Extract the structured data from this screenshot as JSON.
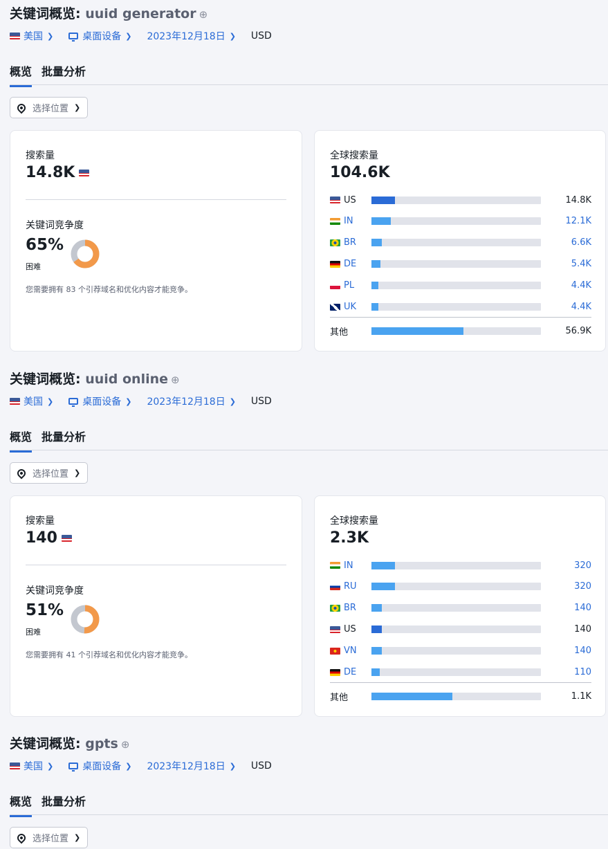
{
  "panels": [
    {
      "title_prefix": "关键词概览: ",
      "keyword": "uuid generator",
      "add_icon": "⊕",
      "filters": {
        "country": "美国",
        "device": "桌面设备",
        "date": "2023年12月18日",
        "currency": "USD"
      },
      "tabs": [
        "概览",
        "批量分析"
      ],
      "location": "选择位置",
      "volume_label": "搜索量",
      "volume": "14.8K",
      "kd_label": "关键词竞争度",
      "kd_value": "65%",
      "kd_percent": 65,
      "kd_level": "困难",
      "kd_note": "您需要拥有 83 个引荐域名和优化内容才能竞争。",
      "global_label": "全球搜索量",
      "global_volume": "104.6K",
      "countries": [
        {
          "code": "US",
          "value": "14.8K",
          "share": 0.14
        },
        {
          "code": "IN",
          "value": "12.1K",
          "share": 0.115
        },
        {
          "code": "BR",
          "value": "6.6K",
          "share": 0.063
        },
        {
          "code": "DE",
          "value": "5.4K",
          "share": 0.052
        },
        {
          "code": "PL",
          "value": "4.4K",
          "share": 0.042
        },
        {
          "code": "UK",
          "value": "4.4K",
          "share": 0.042
        }
      ],
      "other_label": "其他",
      "other_value": "56.9K",
      "other_share": 0.544
    },
    {
      "title_prefix": "关键词概览: ",
      "keyword": "uuid online",
      "add_icon": "⊕",
      "filters": {
        "country": "美国",
        "device": "桌面设备",
        "date": "2023年12月18日",
        "currency": "USD"
      },
      "tabs": [
        "概览",
        "批量分析"
      ],
      "location": "选择位置",
      "volume_label": "搜索量",
      "volume": "140",
      "kd_label": "关键词竞争度",
      "kd_value": "51%",
      "kd_percent": 51,
      "kd_level": "困难",
      "kd_note": "您需要拥有 41 个引荐域名和优化内容才能竞争。",
      "global_label": "全球搜索量",
      "global_volume": "2.3K",
      "countries": [
        {
          "code": "IN",
          "value": "320",
          "share": 0.139
        },
        {
          "code": "RU",
          "value": "320",
          "share": 0.139
        },
        {
          "code": "BR",
          "value": "140",
          "share": 0.061
        },
        {
          "code": "US",
          "value": "140",
          "share": 0.061
        },
        {
          "code": "VN",
          "value": "140",
          "share": 0.061
        },
        {
          "code": "DE",
          "value": "110",
          "share": 0.048
        }
      ],
      "other_label": "其他",
      "other_value": "1.1K",
      "other_share": 0.478
    },
    {
      "title_prefix": "关键词概览: ",
      "keyword": "gpts",
      "add_icon": "⊕",
      "filters": {
        "country": "美国",
        "device": "桌面设备",
        "date": "2023年12月18日",
        "currency": "USD"
      },
      "tabs": [
        "概览",
        "批量分析"
      ],
      "location": "选择位置"
    }
  ],
  "colors": {
    "accent": "#2a6bd6",
    "bar_light": "#4aa3f0",
    "donut": "#f2994a",
    "donut_rest": "#c3c7cf"
  }
}
